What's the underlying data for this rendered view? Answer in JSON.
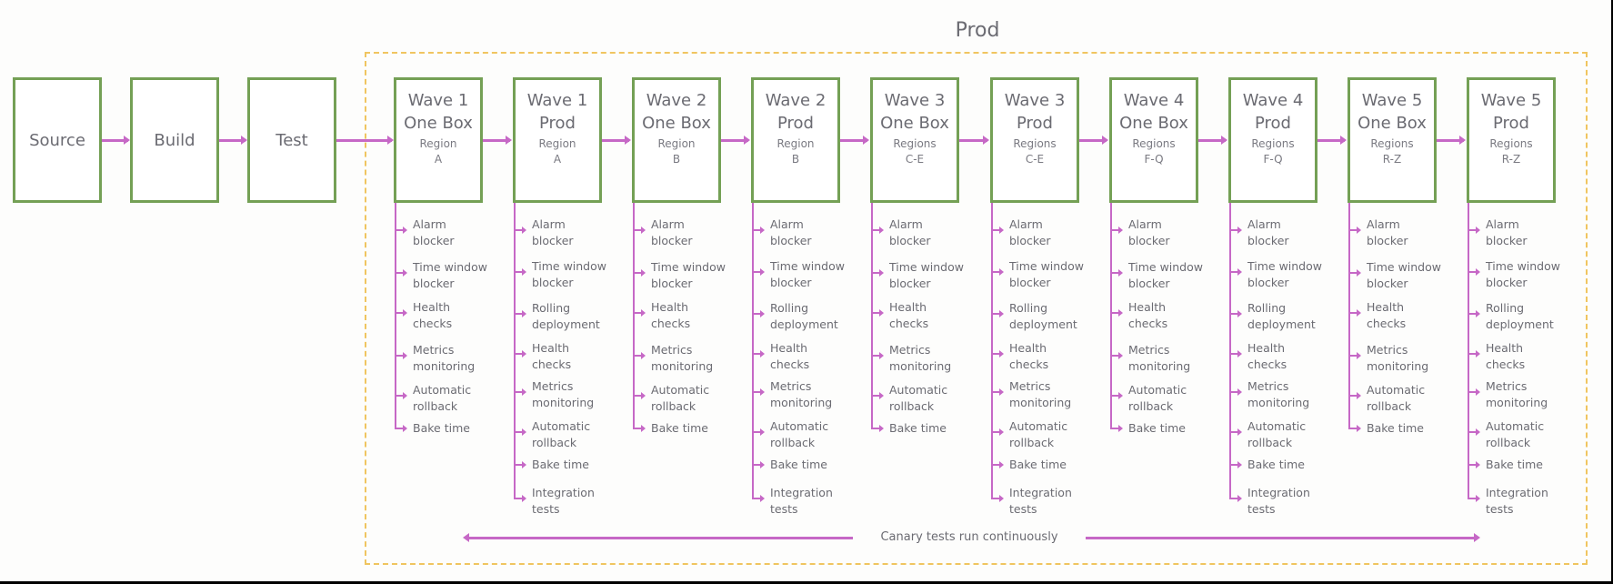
{
  "diagram": {
    "group_title": "Prod",
    "colors": {
      "stage_border": "#74a055",
      "arrow": "#c668c6",
      "group_border": "#f0c560",
      "text": "#6b6b72"
    },
    "pre_stages": [
      {
        "name": "Source"
      },
      {
        "name": "Build"
      },
      {
        "name": "Test"
      }
    ],
    "waves": [
      {
        "line1": "Wave 1",
        "line2": "One Box",
        "region_label": "Region",
        "region": "A",
        "type": "onebox",
        "steps": [
          "Alarm blocker",
          "Time window blocker",
          "Health checks",
          "Metrics monitoring",
          "Automatic rollback",
          "Bake time"
        ]
      },
      {
        "line1": "Wave 1",
        "line2": "Prod",
        "region_label": "Region",
        "region": "A",
        "type": "prod",
        "steps": [
          "Alarm blocker",
          "Time window blocker",
          "Rolling deployment",
          "Health checks",
          "Metrics monitoring",
          "Automatic rollback",
          "Bake time",
          "Integration tests"
        ]
      },
      {
        "line1": "Wave 2",
        "line2": "One Box",
        "region_label": "Region",
        "region": "B",
        "type": "onebox",
        "steps": [
          "Alarm blocker",
          "Time window blocker",
          "Health checks",
          "Metrics monitoring",
          "Automatic rollback",
          "Bake time"
        ]
      },
      {
        "line1": "Wave 2",
        "line2": "Prod",
        "region_label": "Region",
        "region": "B",
        "type": "prod",
        "steps": [
          "Alarm blocker",
          "Time window blocker",
          "Rolling deployment",
          "Health checks",
          "Metrics monitoring",
          "Automatic rollback",
          "Bake time",
          "Integration tests"
        ]
      },
      {
        "line1": "Wave 3",
        "line2": "One Box",
        "region_label": "Regions",
        "region": "C-E",
        "type": "onebox",
        "steps": [
          "Alarm blocker",
          "Time window blocker",
          "Health checks",
          "Metrics monitoring",
          "Automatic rollback",
          "Bake time"
        ]
      },
      {
        "line1": "Wave 3",
        "line2": "Prod",
        "region_label": "Regions",
        "region": "C-E",
        "type": "prod",
        "steps": [
          "Alarm blocker",
          "Time window blocker",
          "Rolling deployment",
          "Health checks",
          "Metrics monitoring",
          "Automatic rollback",
          "Bake time",
          "Integration tests"
        ]
      },
      {
        "line1": "Wave 4",
        "line2": "One Box",
        "region_label": "Regions",
        "region": "F-Q",
        "type": "onebox",
        "steps": [
          "Alarm blocker",
          "Time window blocker",
          "Health checks",
          "Metrics monitoring",
          "Automatic rollback",
          "Bake time"
        ]
      },
      {
        "line1": "Wave 4",
        "line2": "Prod",
        "region_label": "Regions",
        "region": "F-Q",
        "type": "prod",
        "steps": [
          "Alarm blocker",
          "Time window blocker",
          "Rolling deployment",
          "Health checks",
          "Metrics monitoring",
          "Automatic rollback",
          "Bake time",
          "Integration tests"
        ]
      },
      {
        "line1": "Wave 5",
        "line2": "One Box",
        "region_label": "Regions",
        "region": "R-Z",
        "type": "onebox",
        "steps": [
          "Alarm blocker",
          "Time window blocker",
          "Health checks",
          "Metrics monitoring",
          "Automatic rollback",
          "Bake time"
        ]
      },
      {
        "line1": "Wave 5",
        "line2": "Prod",
        "region_label": "Regions",
        "region": "R-Z",
        "type": "prod",
        "steps": [
          "Alarm blocker",
          "Time window blocker",
          "Rolling deployment",
          "Health checks",
          "Metrics monitoring",
          "Automatic rollback",
          "Bake time",
          "Integration tests"
        ]
      }
    ],
    "canary_label": "Canary tests run continuously"
  }
}
